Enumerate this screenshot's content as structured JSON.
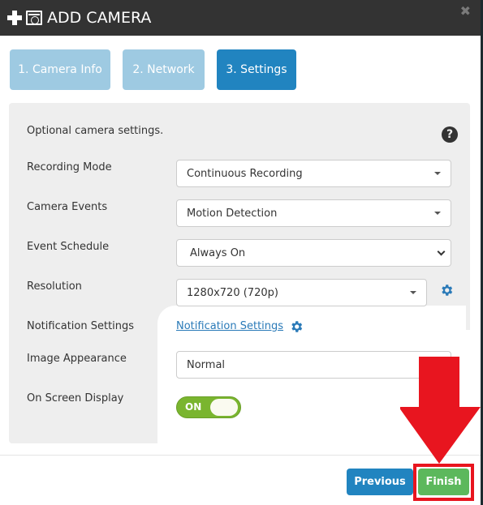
{
  "header": {
    "title": "ADD CAMERA",
    "icons": [
      "plus-icon",
      "camera-icon"
    ],
    "close_label": "✖"
  },
  "steps": [
    {
      "label": "1. Camera Info",
      "state": "inactive"
    },
    {
      "label": "2. Network",
      "state": "inactive"
    },
    {
      "label": "3. Settings",
      "state": "active"
    }
  ],
  "panel": {
    "intro": "Optional camera settings.",
    "help_icon": "?",
    "fields": {
      "recording_mode": {
        "label": "Recording Mode",
        "value": "Continuous Recording"
      },
      "camera_events": {
        "label": "Camera Events",
        "value": "Motion Detection"
      },
      "event_schedule": {
        "label": "Event Schedule",
        "value": "Always On"
      },
      "resolution": {
        "label": "Resolution",
        "value": "1280x720 (720p)"
      },
      "notification_settings": {
        "label": "Notification Settings",
        "link": "Notification Settings"
      },
      "image_appearance": {
        "label": "Image Appearance",
        "value": "Normal"
      },
      "on_screen_display": {
        "label": "On Screen Display",
        "toggle": "ON"
      }
    }
  },
  "footer": {
    "previous_label": "Previous",
    "finish_label": "Finish"
  },
  "colors": {
    "header_bg": "#333333",
    "step_active": "#2184c0",
    "step_inactive": "#9ecae2",
    "finish": "#5cb85c",
    "toggle_on": "#7ab52f",
    "annotation": "#e8151f"
  }
}
